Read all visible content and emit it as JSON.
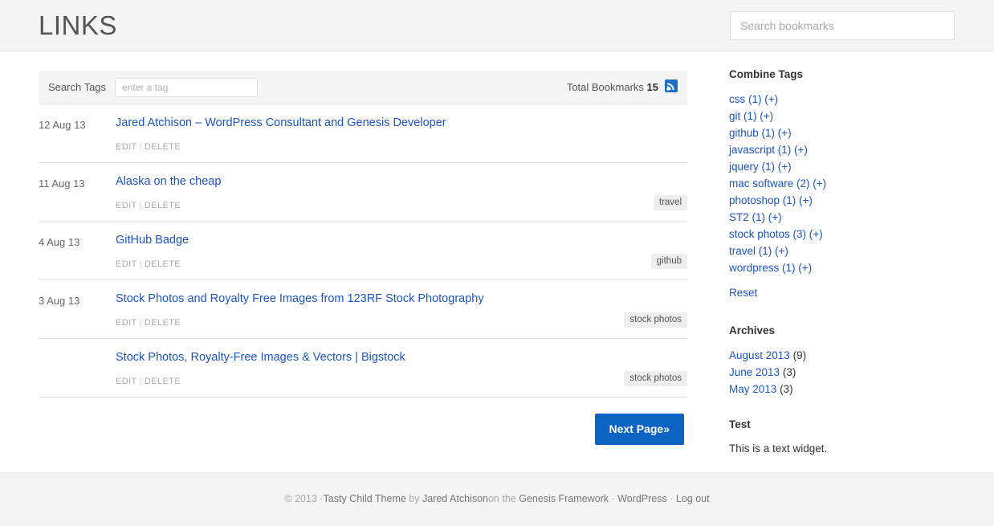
{
  "header": {
    "title": "LINKS",
    "search": {
      "placeholder": "Search bookmarks",
      "value": ""
    }
  },
  "toolbar": {
    "search_tags_label": "Search Tags",
    "tag_input_placeholder": "enter a tag",
    "tag_input_value": "",
    "total_label": "Total Bookmarks",
    "total_count": "15",
    "rss_icon": "rss-feed-icon"
  },
  "bookmarks": [
    {
      "date": "12 Aug 13",
      "title": "Jared Atchison – WordPress Consultant and Genesis Developer",
      "edit": "EDIT",
      "delete": "DELETE",
      "tags": []
    },
    {
      "date": "11 Aug 13",
      "title": "Alaska on the cheap",
      "edit": "EDIT",
      "delete": "DELETE",
      "tags": [
        "travel"
      ]
    },
    {
      "date": "4 Aug 13",
      "title": "GitHub Badge",
      "edit": "EDIT",
      "delete": "DELETE",
      "tags": [
        "github"
      ]
    },
    {
      "date": "3 Aug 13",
      "title": "Stock Photos and Royalty Free Images from 123RF Stock Photography",
      "edit": "EDIT",
      "delete": "DELETE",
      "tags": [
        "stock photos"
      ]
    },
    {
      "date": "",
      "title": "Stock Photos, Royalty-Free Images & Vectors | Bigstock",
      "edit": "EDIT",
      "delete": "DELETE",
      "tags": [
        "stock photos"
      ]
    }
  ],
  "pagination": {
    "next_label": "Next Page»"
  },
  "sidebar": {
    "combine_tags": {
      "title": "Combine Tags",
      "items": [
        {
          "label": "css (1) (+)"
        },
        {
          "label": "git (1) (+)"
        },
        {
          "label": "github (1) (+)"
        },
        {
          "label": "javascript (1) (+)"
        },
        {
          "label": "jquery (1) (+)"
        },
        {
          "label": "mac software (2) (+)"
        },
        {
          "label": "photoshop (1) (+)"
        },
        {
          "label": "ST2 (1) (+)"
        },
        {
          "label": "stock photos (3) (+)"
        },
        {
          "label": "travel (1) (+)"
        },
        {
          "label": "wordpress (1) (+)"
        }
      ],
      "reset_label": "Reset"
    },
    "archives": {
      "title": "Archives",
      "items": [
        {
          "label": "August 2013",
          "count": "(9)"
        },
        {
          "label": "June 2013",
          "count": "(3)"
        },
        {
          "label": "May 2013",
          "count": "(3)"
        }
      ]
    },
    "test_widget": {
      "title": "Test",
      "body": "This is a text widget."
    }
  },
  "footer": {
    "copyright": "© 2013 ·",
    "theme_link": "Tasty Child Theme",
    "by": " by ",
    "author_link": "Jared Atchison",
    "on_the": "on the ",
    "framework_link": "Genesis Framework",
    "sep1": " · ",
    "wordpress_link": "WordPress",
    "sep2": " · ",
    "logout_link": "Log out"
  },
  "colors": {
    "link": "#1b54c4",
    "button": "#0b64c2",
    "header_bg": "#f4f4f4",
    "tag_chip": "#eeeeee"
  }
}
